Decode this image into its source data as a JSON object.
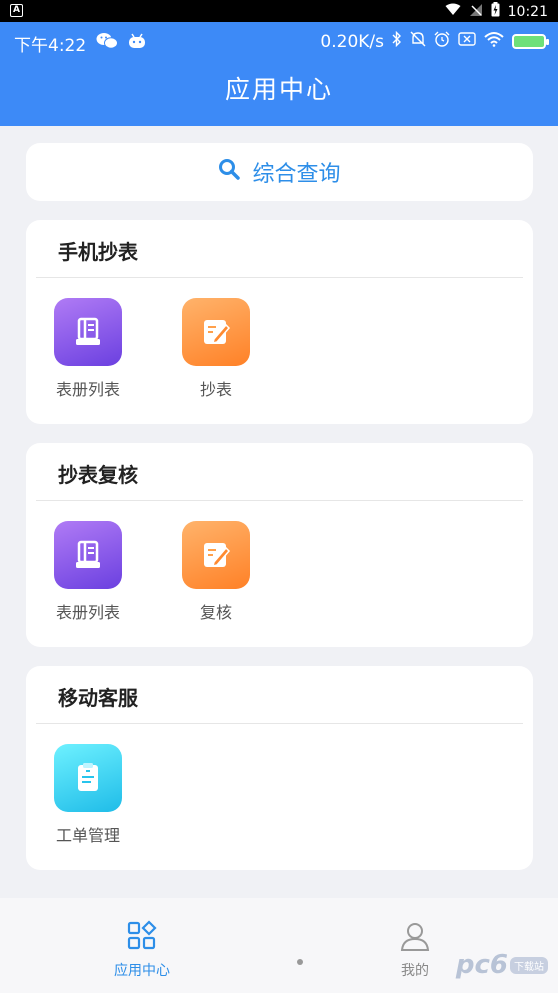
{
  "system_bar": {
    "left_badge": "A",
    "time": "10:21"
  },
  "status_row": {
    "time": "下午4:22",
    "network_speed": "0.20K/s"
  },
  "header": {
    "title": "应用中心"
  },
  "search": {
    "label": "综合查询"
  },
  "sections": [
    {
      "title": "手机抄表",
      "apps": [
        {
          "label": "表册列表",
          "icon": "book-icon",
          "color": "purple"
        },
        {
          "label": "抄表",
          "icon": "edit-icon",
          "color": "orange"
        }
      ]
    },
    {
      "title": "抄表复核",
      "apps": [
        {
          "label": "表册列表",
          "icon": "book-icon",
          "color": "purple"
        },
        {
          "label": "复核",
          "icon": "edit-icon",
          "color": "orange"
        }
      ]
    },
    {
      "title": "移动客服",
      "apps": [
        {
          "label": "工单管理",
          "icon": "clipboard-icon",
          "color": "cyan"
        }
      ]
    }
  ],
  "bottom_nav": [
    {
      "label": "应用中心",
      "icon": "apps-grid-icon",
      "active": true,
      "color": "#2d8ee8"
    },
    {
      "label": "我的",
      "icon": "user-icon",
      "active": false,
      "color": "#888888"
    }
  ],
  "watermark": {
    "text": "pc6",
    "badge": "下载站"
  }
}
